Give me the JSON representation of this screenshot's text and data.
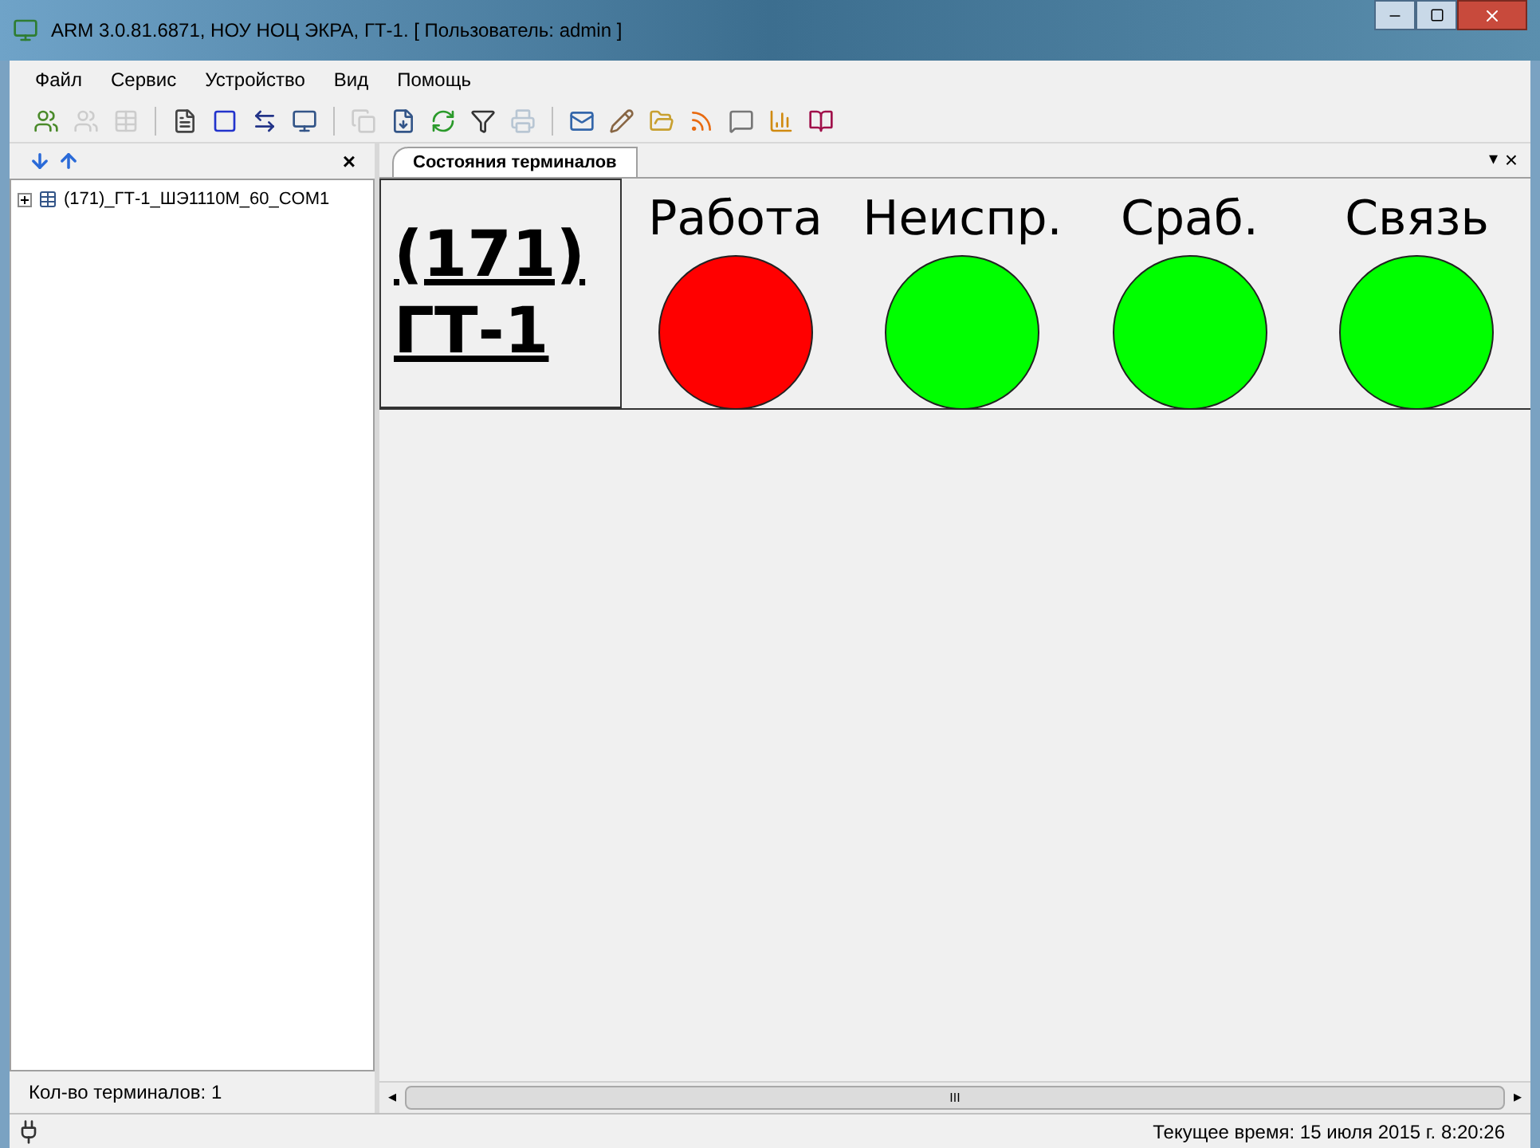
{
  "window": {
    "title": "ARM 3.0.81.6871, НОУ НОЦ ЭКРА, ГТ-1. [ Пользователь: admin ]"
  },
  "menu": [
    {
      "label": "Файл"
    },
    {
      "label": "Сервис"
    },
    {
      "label": "Устройство"
    },
    {
      "label": "Вид"
    },
    {
      "label": "Помощь"
    }
  ],
  "sidebar": {
    "close": "×",
    "items": [
      {
        "label": "(171)_ГТ-1_ШЭ1110М_60_COM1",
        "expanded": false
      }
    ],
    "footer": "Кол-во терминалов: 1"
  },
  "tabs": [
    {
      "label": "Состояния терминалов",
      "selected": true
    }
  ],
  "tab_controls": {
    "menu": "▾",
    "close": "×"
  },
  "terminal": {
    "lines": [
      "(171)",
      "ГТ-1"
    ]
  },
  "indicators": [
    {
      "label": "Работа",
      "color": "#ff0000"
    },
    {
      "label": "Неиспр.",
      "color": "#00ff00"
    },
    {
      "label": "Сраб.",
      "color": "#00ff00"
    },
    {
      "label": "Связь",
      "color": "#00ff00"
    }
  ],
  "scrollbar": {
    "left": "◂",
    "grip": "III",
    "right": "▸"
  },
  "status_bar": {
    "time": "Текущее время: 15 июля 2015 г. 8:20:26"
  }
}
